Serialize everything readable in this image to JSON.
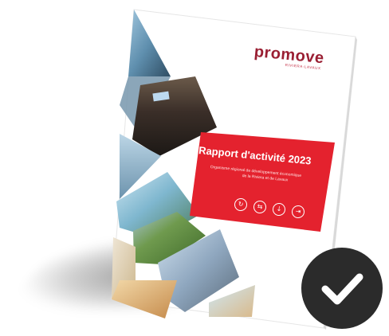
{
  "brochure": {
    "logo_text": "promove",
    "logo_tagline": "RIVIERA-LAVAUX",
    "title": "Rapport d'activité 2023",
    "subtitle_line1": "Organisme régional de développement économique",
    "subtitle_line2": "de la Riviera et de Lavaux",
    "icons": [
      "refresh-icon",
      "arrows-icon",
      "download-icon",
      "share-icon"
    ],
    "accent_color": "#e4222e",
    "logo_color": "#9a1f33"
  },
  "badge": {
    "icon": "checkmark-icon",
    "background_color": "#2b2b2b",
    "check_color": "#ffffff"
  }
}
